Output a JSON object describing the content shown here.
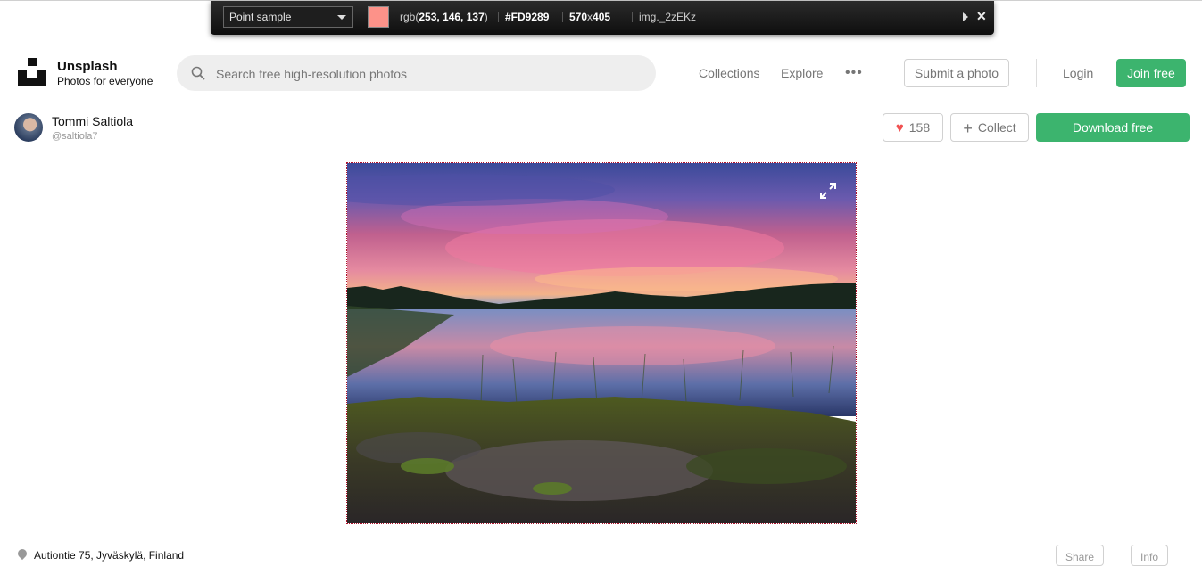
{
  "colorpicker": {
    "mode": "Point sample",
    "swatch_color": "#FD9289",
    "rgb_prefix": "rgb(",
    "rgb_values": "253, 146, 137",
    "rgb_suffix": ")",
    "hex": "#FD9289",
    "width": "570",
    "times": "x",
    "height": "405",
    "element": "img._2zEKz"
  },
  "header": {
    "brand": "Unsplash",
    "tagline": "Photos for everyone",
    "search_placeholder": "Search free high-resolution photos",
    "nav_collections": "Collections",
    "nav_explore": "Explore",
    "more": "•••",
    "submit": "Submit a photo",
    "login": "Login",
    "join": "Join free"
  },
  "author": {
    "name": "Tommi Saltiola",
    "handle": "@saltiola7"
  },
  "actions": {
    "likes": "158",
    "collect": "Collect",
    "download": "Download free"
  },
  "footer": {
    "location": "Autiontie 75, Jyväskylä, Finland",
    "share": "Share",
    "info": "Info"
  },
  "colors": {
    "accent_green": "#3cb46e",
    "heart_red": "#f15151"
  }
}
